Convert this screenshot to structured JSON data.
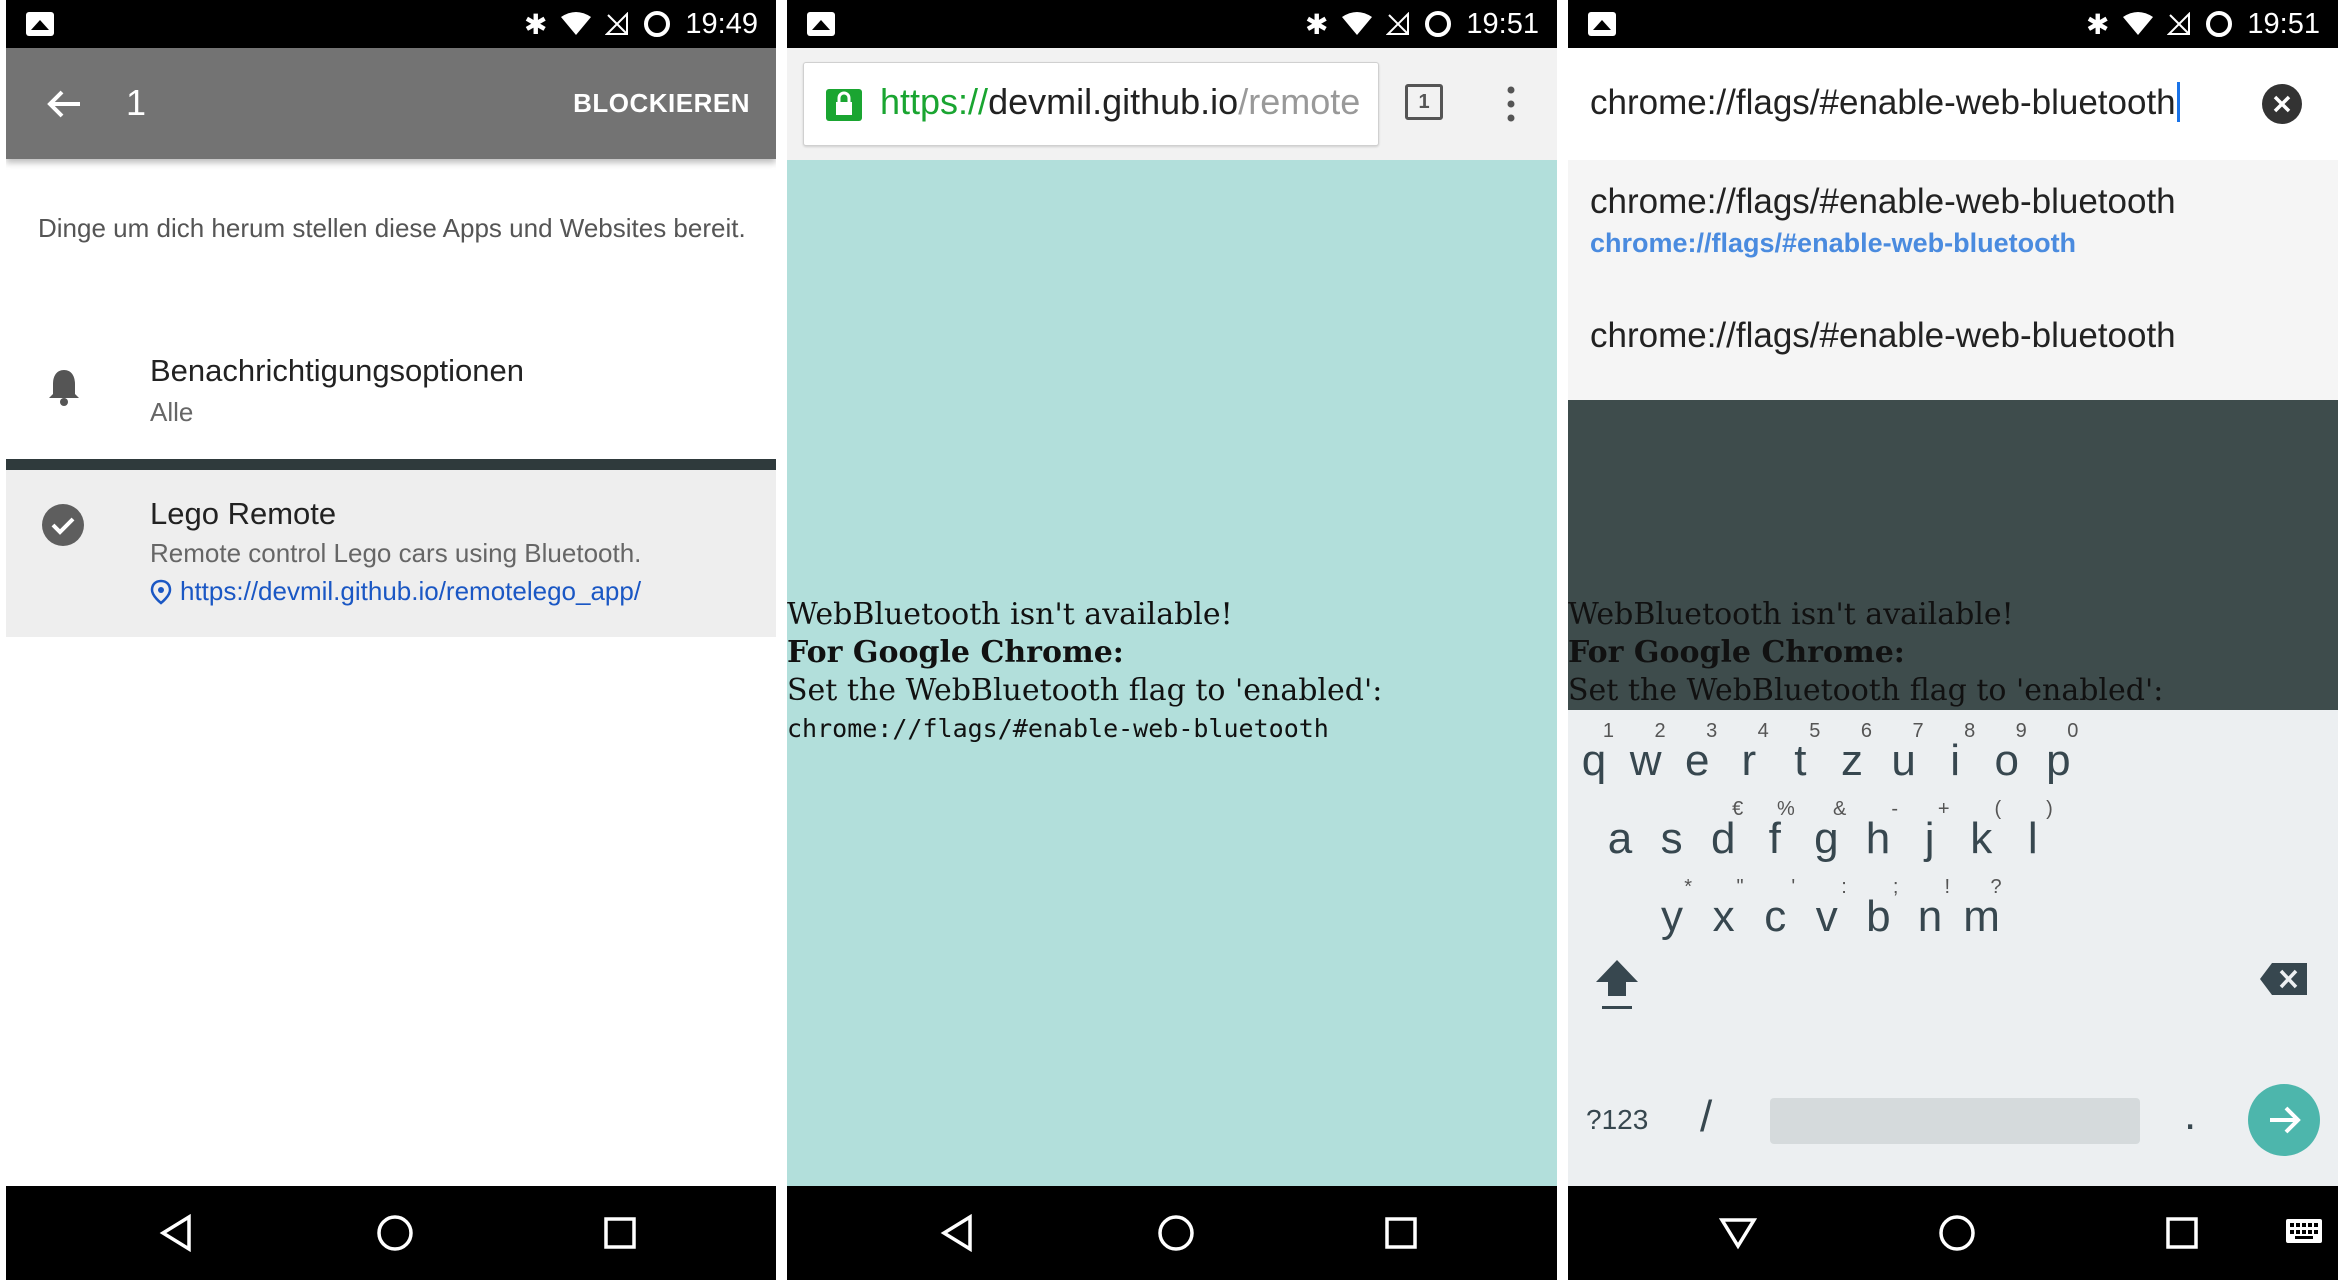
{
  "panel1": {
    "status": {
      "time": "19:49"
    },
    "toolbar": {
      "title": "1",
      "action": "BLOCKIEREN"
    },
    "description": "Dinge um dich herum stellen diese Apps und Websites bereit.",
    "notification": {
      "title": "Benachrichtigungsoptionen",
      "value": "Alle"
    },
    "item": {
      "title": "Lego Remote",
      "description": "Remote control Lego cars using Bluetooth.",
      "url": "https://devmil.github.io/remotelego_app/"
    }
  },
  "panel2": {
    "status": {
      "time": "19:51"
    },
    "omnibox": {
      "scheme": "https://",
      "host": "devmil.github.io",
      "path": "/remote"
    },
    "tab_count": "1",
    "message": {
      "line1": "WebBluetooth isn't available!",
      "line2": "For Google Chrome:",
      "line3": "Set the WebBluetooth flag to 'enabled':",
      "line4": "chrome://flags/#enable-web-bluetooth"
    },
    "background_color": "#b2dfdb"
  },
  "panel3": {
    "status": {
      "time": "19:51"
    },
    "input_value": "chrome://flags/#enable-web-bluetooth",
    "suggestions": [
      {
        "title": "chrome://flags/#enable-web-bluetooth",
        "url": "chrome://flags/#enable-web-bluetooth"
      },
      {
        "title": "chrome://flags/#enable-web-bluetooth"
      }
    ],
    "message": {
      "line1": "WebBluetooth isn't available!",
      "line2": "For Google Chrome:",
      "line3": "Set the WebBluetooth flag to 'enabled':"
    },
    "keyboard": {
      "row1": [
        {
          "key": "q",
          "hint": "1"
        },
        {
          "key": "w",
          "hint": "2"
        },
        {
          "key": "e",
          "hint": "3"
        },
        {
          "key": "r",
          "hint": "4"
        },
        {
          "key": "t",
          "hint": "5"
        },
        {
          "key": "z",
          "hint": "6"
        },
        {
          "key": "u",
          "hint": "7"
        },
        {
          "key": "i",
          "hint": "8"
        },
        {
          "key": "o",
          "hint": "9"
        },
        {
          "key": "p",
          "hint": "0"
        }
      ],
      "row2": [
        {
          "key": "a",
          "hint": ""
        },
        {
          "key": "s",
          "hint": ""
        },
        {
          "key": "d",
          "hint": "€"
        },
        {
          "key": "f",
          "hint": "%"
        },
        {
          "key": "g",
          "hint": "&"
        },
        {
          "key": "h",
          "hint": "-"
        },
        {
          "key": "j",
          "hint": "+"
        },
        {
          "key": "k",
          "hint": "("
        },
        {
          "key": "l",
          "hint": ")"
        }
      ],
      "row3": [
        {
          "key": "y",
          "hint": "*"
        },
        {
          "key": "x",
          "hint": "\""
        },
        {
          "key": "c",
          "hint": "'"
        },
        {
          "key": "v",
          "hint": ":"
        },
        {
          "key": "b",
          "hint": ";"
        },
        {
          "key": "n",
          "hint": "!"
        },
        {
          "key": "m",
          "hint": "?"
        }
      ],
      "symbols_label": "?123",
      "slash": "/",
      "period": "."
    }
  },
  "colors": {
    "accent_green": "#1aa531",
    "link_blue": "#1a57c4",
    "teal": "#4db6ac"
  }
}
